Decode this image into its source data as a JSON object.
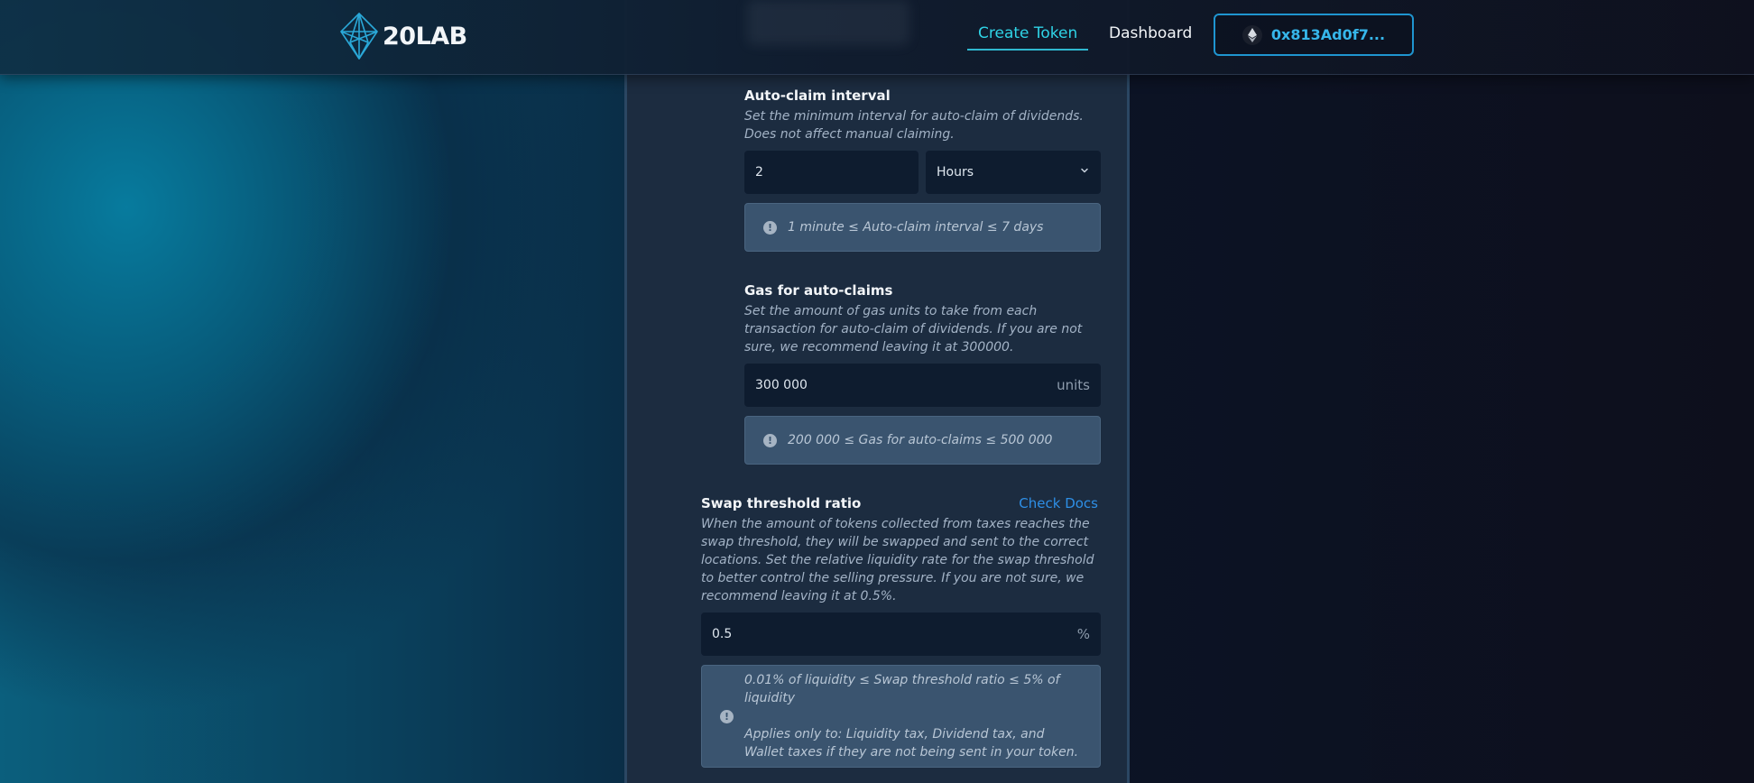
{
  "header": {
    "logo_text": "20LAB",
    "nav_create": "Create Token",
    "nav_dashboard": "Dashboard",
    "wallet_address": "0x813Ad0f7..."
  },
  "form": {
    "auto_claim": {
      "title": "Auto-claim interval",
      "description": "Set the minimum interval for auto-claim of dividends. Does not affect manual claiming.",
      "value": "2",
      "unit_selected": "Hours",
      "hint": "1 minute ≤ Auto-claim interval ≤ 7 days"
    },
    "gas": {
      "title": "Gas for auto-claims",
      "description": "Set the amount of gas units to take from each transaction for auto-claim of dividends. If you are not sure, we recommend leaving it at 300000.",
      "value": "300 000",
      "suffix": "units",
      "hint": "200 000 ≤ Gas for auto-claims ≤ 500 000"
    },
    "swap": {
      "title": "Swap threshold ratio",
      "docs_link": "Check Docs",
      "description": "When the amount of tokens collected from taxes reaches the swap threshold, they will be swapped and sent to the correct locations. Set the relative liquidity rate for the swap threshold to better control the selling pressure. If you are not sure, we recommend leaving it at 0.5%.",
      "value": "0.5",
      "suffix": "%",
      "hint_range": "0.01% of liquidity ≤ Swap threshold ratio ≤ 5% of liquidity",
      "hint_applies": "Applies only to: Liquidity tax, Dividend tax, and Wallet taxes if they are not being sent in your token."
    }
  },
  "icons": {
    "logo": "diamond-logo-icon",
    "eth": "ethereum-icon",
    "chevron": "chevron-down-icon",
    "hint": "exclamation-circle-icon"
  }
}
